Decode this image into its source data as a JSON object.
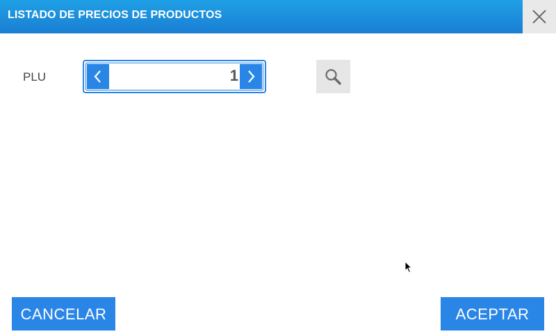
{
  "dialog": {
    "title": "LISTADO DE PRECIOS DE PRODUCTOS",
    "close_icon": "close-icon"
  },
  "form": {
    "plu_label": "PLU",
    "plu_value": "1",
    "decrement_icon": "chevron-left-icon",
    "increment_icon": "chevron-right-icon",
    "search_icon": "search-icon"
  },
  "footer": {
    "cancel_label": "CANCELAR",
    "accept_label": "ACEPTAR"
  },
  "colors": {
    "accent": "#2a86e6",
    "titlebar": "#1a7ed3",
    "close_bg": "#e9e9e9",
    "search_bg": "#e6e6e6"
  }
}
